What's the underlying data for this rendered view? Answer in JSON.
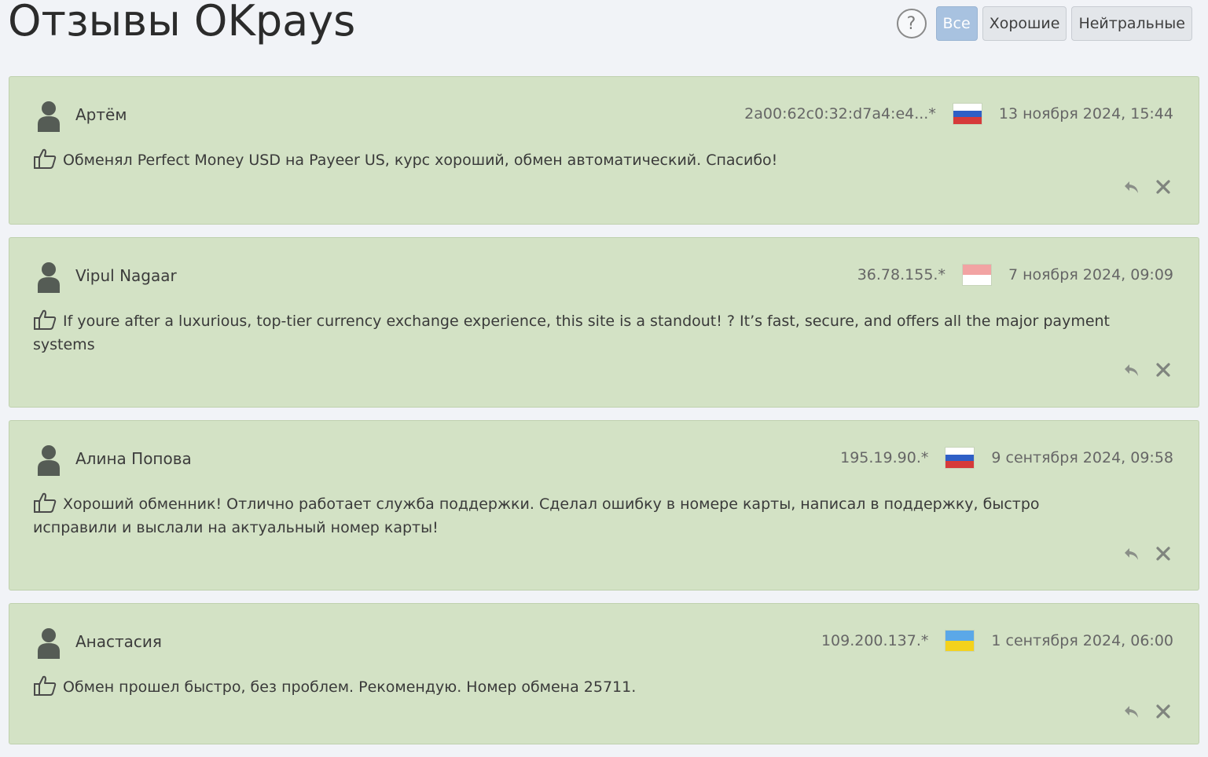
{
  "page": {
    "title": "Отзывы OKpays"
  },
  "filters": {
    "help_label": "?",
    "items": [
      {
        "label": "Все",
        "active": true
      },
      {
        "label": "Хорошие",
        "active": false
      },
      {
        "label": "Нейтральные",
        "active": false
      }
    ]
  },
  "icons": {
    "avatar": "user-avatar-icon",
    "rating": "thumbs-up-icon",
    "reply": "reply-icon",
    "delete": "close-icon",
    "help": "question-icon"
  },
  "colors": {
    "review_bg": "#d3e2c5",
    "active_filter": "#a8c2e0",
    "page_bg": "#f1f3f7"
  },
  "reviews": [
    {
      "author": "Артём",
      "ip": "2a00:62c0:32:d7a4:e4...*",
      "flag": "russia",
      "date": "13 ноября 2024, 15:44",
      "text": "Обменял Perfect Money USD на Payeer US, курс хороший, обмен автоматический. Спасибо!"
    },
    {
      "author": "Vipul Nagaar",
      "ip": "36.78.155.*",
      "flag": "indonesia",
      "date": "7 ноября 2024, 09:09",
      "text": "If youre after a luxurious, top-tier currency exchange experience, this site is a standout! ? It’s fast, secure, and offers all the major payment systems"
    },
    {
      "author": "Алина Попова",
      "ip": "195.19.90.*",
      "flag": "russia",
      "date": "9 сентября 2024, 09:58",
      "text": "Хороший обменник! Отлично работает служба поддержки. Сделал ошибку в номере карты, написал в поддержку, быстро исправили и выслали на актуальный номер карты!"
    },
    {
      "author": "Анастасия",
      "ip": "109.200.137.*",
      "flag": "ukraine",
      "date": "1 сентября 2024, 06:00",
      "text": "Обмен прошел быстро, без проблем. Рекомендую. Номер обмена 25711."
    }
  ]
}
